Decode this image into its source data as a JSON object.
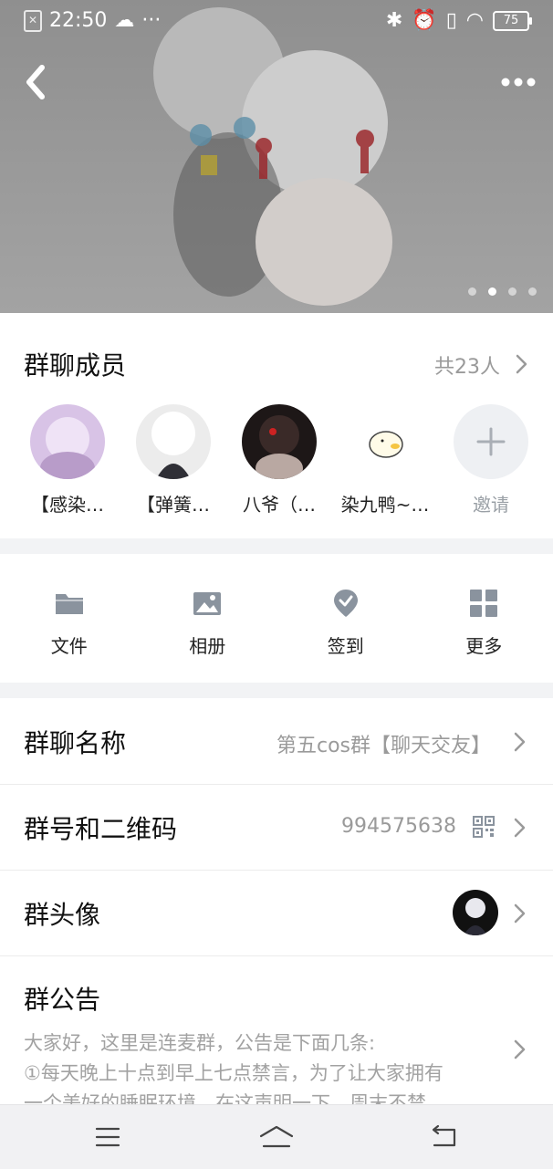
{
  "status_bar": {
    "time": "22:50",
    "extra": "···",
    "battery": "75"
  },
  "header": {
    "back_icon": "chevron-left-icon",
    "more_icon": "more-horizontal-icon",
    "carousel_dot_count": 4,
    "carousel_active_index": 1
  },
  "members": {
    "title": "群聊成员",
    "count_label": "共23人",
    "items": [
      {
        "name": "【感染…",
        "avatar": "avatar-purple-anime-icon"
      },
      {
        "name": "【弹簧…",
        "avatar": "avatar-white-hair-icon"
      },
      {
        "name": "八爷（…",
        "avatar": "avatar-dark-anime-icon"
      },
      {
        "name": "染九鸭~…",
        "avatar": "avatar-duck-icon"
      }
    ],
    "invite_label": "邀请"
  },
  "tools": [
    {
      "label": "文件",
      "icon": "folder-icon"
    },
    {
      "label": "相册",
      "icon": "image-icon"
    },
    {
      "label": "签到",
      "icon": "check-badge-icon"
    },
    {
      "label": "更多",
      "icon": "grid-icon"
    }
  ],
  "settings": {
    "group_name_label": "群聊名称",
    "group_name_value": "第五cos群【聊天交友】",
    "group_id_label": "群号和二维码",
    "group_id_value": "994575638",
    "group_avatar_label": "群头像",
    "notice_title": "群公告",
    "notice_lines": [
      "大家好，这里是连麦群，公告是下面几条:",
      "①每天晚上十点到早上七点禁言，为了让大家拥有",
      "一个美好的睡眠环境，在这声明一下，周末不禁"
    ]
  },
  "colors": {
    "accent_gray": "#9a9a9a",
    "icon_gray": "#8a939e",
    "divider": "#f2f3f5"
  }
}
